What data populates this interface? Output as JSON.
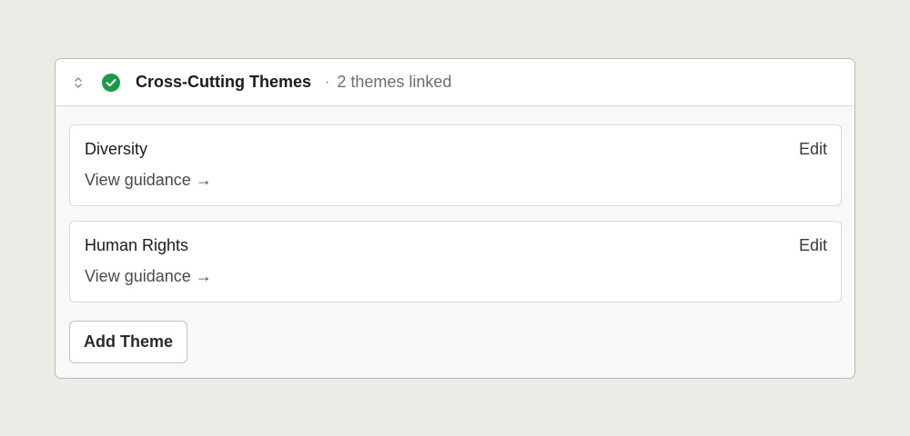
{
  "section": {
    "title": "Cross-Cutting Themes",
    "separator": "·",
    "count_text": "2 themes linked",
    "status": "complete",
    "colors": {
      "status_green": "#1a9b46"
    },
    "icons": {
      "toggle": "chevron-up-down-icon",
      "status": "check-circle-icon"
    }
  },
  "themes": [
    {
      "name": "Diversity",
      "edit_label": "Edit",
      "guidance_label": "View guidance →"
    },
    {
      "name": "Human Rights",
      "edit_label": "Edit",
      "guidance_label": "View guidance →"
    }
  ],
  "actions": {
    "add_label": "Add Theme"
  }
}
